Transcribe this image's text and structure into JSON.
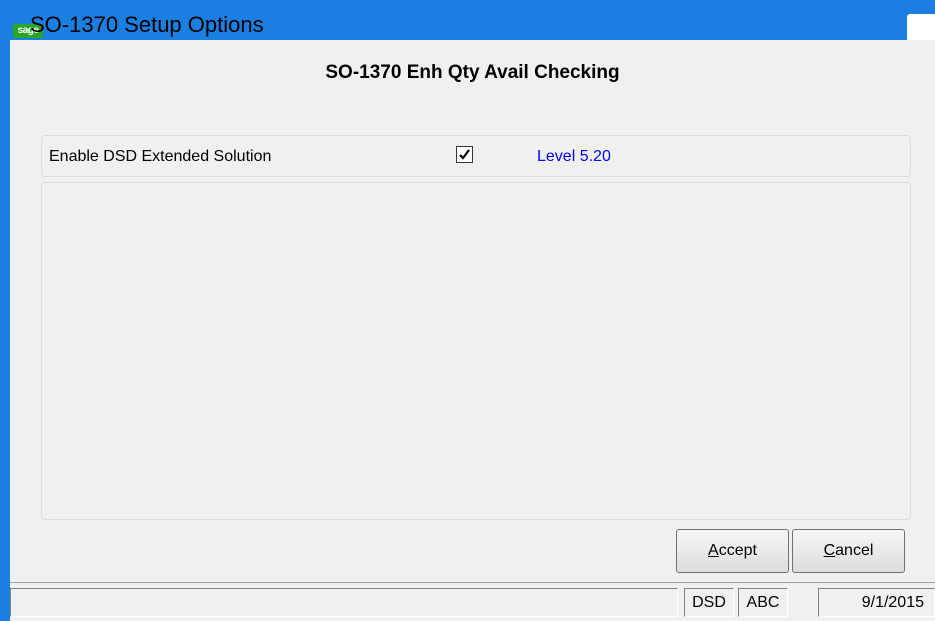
{
  "window": {
    "title": "SO-1370 Setup Options",
    "app_icon_label": "sage",
    "accent_color": "#1a7fe0"
  },
  "header": {
    "title": "SO-1370 Enh Qty Avail Checking"
  },
  "option": {
    "label": "Enable DSD Extended Solution",
    "checked": true,
    "level": "Level  5.20",
    "level_color": "#0000ff"
  },
  "buttons": {
    "accept_first": "A",
    "accept_rest": "ccept",
    "cancel_first": "C",
    "cancel_rest": "ancel"
  },
  "statusbar": {
    "message": "",
    "cell1": "DSD",
    "cell2": "ABC",
    "date": "9/1/2015"
  }
}
